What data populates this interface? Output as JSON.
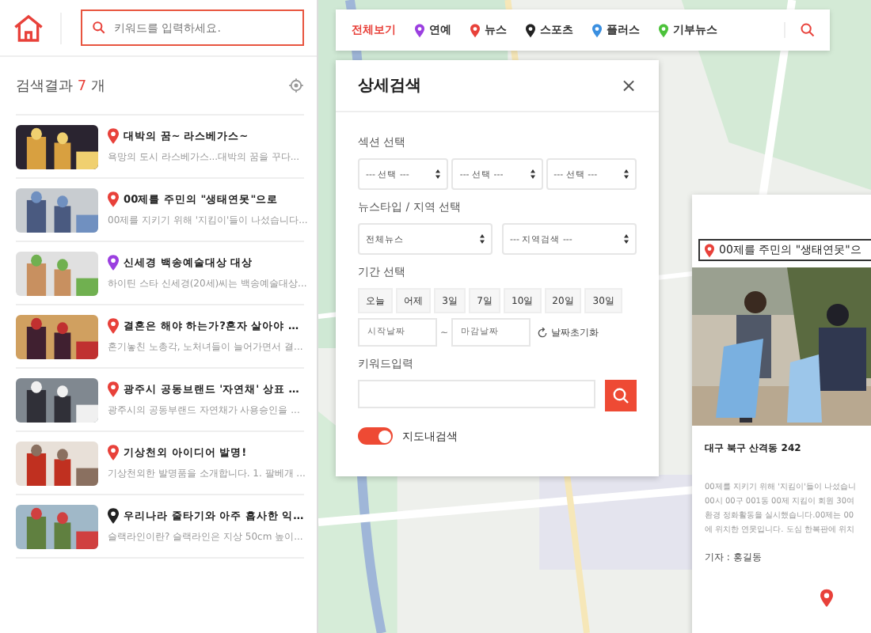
{
  "header": {
    "search": {
      "placeholder": "키워드를 입력하세요."
    }
  },
  "results": {
    "label": "검색결과",
    "count": "7",
    "unit": "개"
  },
  "items": [
    {
      "title": "대박의 꿈~ 라스베가스~",
      "desc": "욕망의 도시 라스베가스...대박의 꿈을 꾸다...",
      "color": "#e8413a"
    },
    {
      "title": "00제를 주민의 \"생태연못\"으로",
      "desc": "00제를 지키기 위해 '지킴이'들이 나섰습니다...",
      "color": "#e8413a"
    },
    {
      "title": "신세경 백송예술대상 대상",
      "desc": "하이틴 스타 신세경(20세)씨는 백송예술대상...",
      "color": "#9b3fe0"
    },
    {
      "title": "결혼은 해야 하는가?혼자 살아야 …",
      "desc": "혼기놓친 노총각, 노처녀들이 늘어가면서 결...",
      "color": "#e8413a"
    },
    {
      "title": "광주시 공동브랜드 '자연채' 상표 …",
      "desc": "광주시의 공동부랜드 자연채가 사용승인을 ...",
      "color": "#e8413a"
    },
    {
      "title": "기상천외 아이디어 발명!",
      "desc": "기상천외한 발명품을 소개합니다. 1. 팔베개 ...",
      "color": "#e8413a"
    },
    {
      "title": "우리나라 줄타기와 아주 흡사한 익…",
      "desc": "슬랙라인이란? 슬랙라인은 지상 50cm 높이...",
      "color": "#222222"
    }
  ],
  "categories": [
    {
      "label": "전체보기",
      "selected": true
    },
    {
      "label": "연예",
      "selected": false,
      "color": "#9b3fe0"
    },
    {
      "label": "뉴스",
      "selected": false,
      "color": "#e8413a"
    },
    {
      "label": "스포츠",
      "selected": false,
      "color": "#222222"
    },
    {
      "label": "플러스",
      "selected": false,
      "color": "#3a8fe0"
    },
    {
      "label": "기부뉴스",
      "selected": false,
      "color": "#4cc23a"
    }
  ],
  "detail": {
    "title": "상세검색",
    "close": "×",
    "section_label": "섹션 선택",
    "section_selects": [
      "--- 선택 ---",
      "--- 선택 ---",
      "--- 선택 ---"
    ],
    "type_label": "뉴스타입 / 지역 선택",
    "type_selects": [
      "전체뉴스",
      "--- 지역검색 ---"
    ],
    "period_label": "기간 선택",
    "periods": [
      "오늘",
      "어제",
      "3일",
      "7일",
      "10일",
      "20일",
      "30일"
    ],
    "start": {
      "placeholder": "시작날짜"
    },
    "dash": "~",
    "end": {
      "placeholder": "마감날짜"
    },
    "reset": "날짜초기화",
    "keyword_label": "키워드입력",
    "map_toggle": {
      "label": "지도내검색",
      "on": true
    }
  },
  "popup": {
    "title": "00제를 주민의 \"생태연못\"으",
    "address": "대구 북구 산격동 242",
    "lines": [
      "00제를 지키기 위해 '지킴이'들이 나섰습니",
      "00시 00구 001동 00제 지킴이 회원 30여",
      "환경 정화활동을 실시했습니다.00제는 00",
      "에 위치한 연못입니다. 도심 한복판에 위치"
    ],
    "reporter": "기자 : 홍길동"
  }
}
